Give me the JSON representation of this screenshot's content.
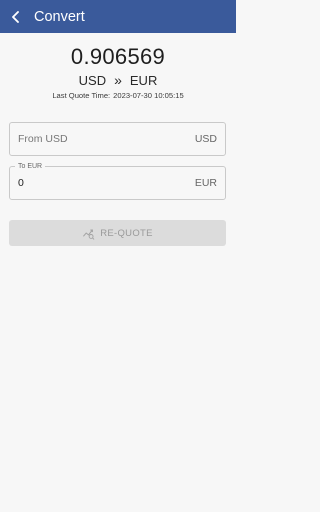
{
  "theme": {
    "brand_color": "#3a5a9b"
  },
  "header": {
    "title": "Convert",
    "back_icon": "chevron-left-icon"
  },
  "rate": {
    "value": "0.906569",
    "from_currency": "USD",
    "separator": "»",
    "to_currency": "EUR",
    "quote_time_label": "Last Quote Time:",
    "quote_time": "2023-07-30 10:05:15"
  },
  "from_field": {
    "placeholder": "From USD",
    "value": "",
    "currency": "USD"
  },
  "to_field": {
    "label": "To EUR",
    "value": "0",
    "currency": "EUR"
  },
  "requote_button": {
    "label": "RE-QUOTE",
    "icon": "chart-refresh-icon"
  }
}
